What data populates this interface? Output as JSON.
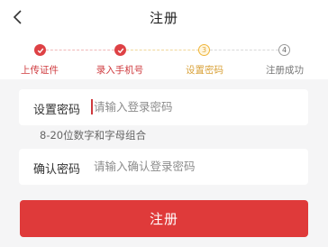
{
  "header": {
    "back_icon": "chevron-left-icon",
    "title": "注册"
  },
  "steps": [
    {
      "label": "上传证件",
      "state": "done",
      "icon": "check-icon"
    },
    {
      "label": "录入手机号",
      "state": "done",
      "icon": "check-icon"
    },
    {
      "label": "设置密码",
      "state": "current",
      "number": "3"
    },
    {
      "label": "注册成功",
      "state": "todo",
      "number": "4"
    }
  ],
  "form": {
    "password_label": "设置密码",
    "password_placeholder": "请输入登录密码",
    "password_hint": "8-20位数字和字母组合",
    "confirm_label": "确认密码",
    "confirm_placeholder": "请输入确认登录密码"
  },
  "submit_label": "注册",
  "colors": {
    "primary_red": "#df3a3a",
    "current_step_orange": "#f0b53a",
    "background": "#f5f5f6"
  }
}
